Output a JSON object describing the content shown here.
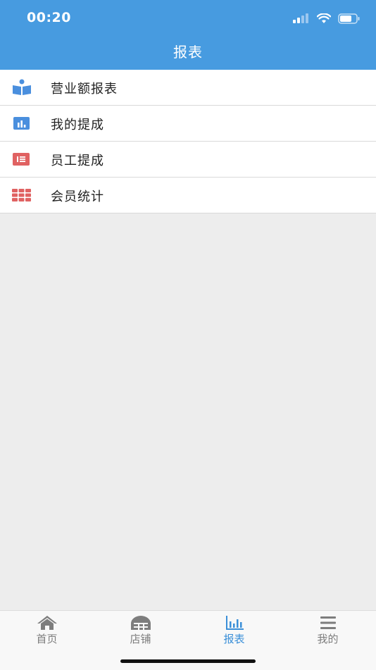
{
  "status_bar": {
    "time": "00:20"
  },
  "header": {
    "title": "报表"
  },
  "menu": {
    "items": [
      {
        "label": "营业额报表",
        "icon": "book-icon",
        "color": "#4a8fde"
      },
      {
        "label": "我的提成",
        "icon": "bar-chart-icon",
        "color": "#4a8fde"
      },
      {
        "label": "员工提成",
        "icon": "list-icon",
        "color": "#e06262"
      },
      {
        "label": "会员统计",
        "icon": "grid-icon",
        "color": "#e06262"
      }
    ]
  },
  "tabbar": {
    "tabs": [
      {
        "label": "首页",
        "icon": "home-icon",
        "active": false
      },
      {
        "label": "店铺",
        "icon": "store-icon",
        "active": false
      },
      {
        "label": "报表",
        "icon": "chart-icon",
        "active": true
      },
      {
        "label": "我的",
        "icon": "menu-icon",
        "active": false
      }
    ]
  },
  "colors": {
    "primary": "#479be0",
    "active_tab": "#3a8fd8",
    "background": "#ededed"
  }
}
